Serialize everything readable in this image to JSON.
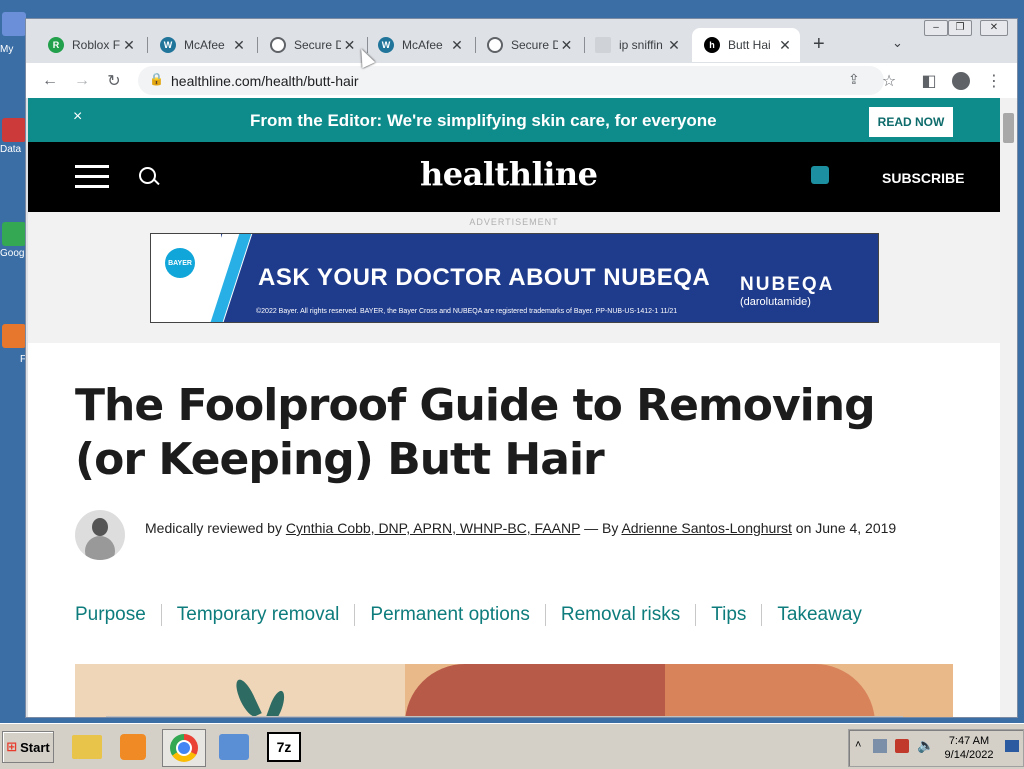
{
  "desktop": {
    "icons": [
      {
        "label": "My",
        "color": "#6b8fd8"
      },
      {
        "label": "Data",
        "color": "#cc3a3a"
      },
      {
        "label": "Goog",
        "color": "#34a853"
      },
      {
        "label": "F",
        "color": "#e8772e"
      }
    ]
  },
  "browser": {
    "tabs": [
      {
        "title": "Roblox F",
        "icon": "roblox-icon",
        "color": "#22a04b",
        "letter": "R"
      },
      {
        "title": "McAfee",
        "icon": "wordpress-icon",
        "color": "#21759b",
        "letter": "W"
      },
      {
        "title": "Secure D",
        "icon": "globe-icon",
        "color": "#5f6368",
        "letter": ""
      },
      {
        "title": "McAfee",
        "icon": "wordpress-icon",
        "color": "#21759b",
        "letter": "W"
      },
      {
        "title": "Secure D",
        "icon": "globe-icon",
        "color": "#5f6368",
        "letter": ""
      },
      {
        "title": "ip sniffin",
        "icon": "search-site-icon",
        "color": "#9aa0a6",
        "letter": ""
      },
      {
        "title": "Butt Hai",
        "icon": "healthline-icon",
        "color": "#000000",
        "letter": ""
      }
    ],
    "new_tab": "+",
    "url": "healthline.com/health/butt-hair"
  },
  "page": {
    "banner_text": "From the Editor: We're simplifying skin care, for everyone",
    "banner_close": "×",
    "read_now": "READ NOW",
    "logo": "healthline",
    "subscribe": "SUBSCRIBE",
    "ad_label": "ADVERTISEMENT",
    "ad": {
      "headline": "ASK YOUR DOCTOR ABOUT NUBEQA",
      "brand": "NUBEQA",
      "brand_sub": "(darolutamide)",
      "bayer": "BAYER",
      "fine_print": "©2022 Bayer. All rights reserved. BAYER, the Bayer Cross and NUBEQA are registered trademarks of Bayer. PP-NUB-US-1412-1 11/21"
    },
    "title": "The Foolproof Guide to Removing (or Keeping) Butt Hair",
    "byline": {
      "prefix": "Medically reviewed by ",
      "reviewer": "Cynthia Cobb, DNP, APRN, WHNP-BC, FAANP",
      "mid": " — By ",
      "author": "Adrienne Santos-Longhurst",
      "suffix": " on June 4, 2019"
    },
    "toc": [
      "Purpose",
      "Temporary removal",
      "Permanent options",
      "Removal risks",
      "Tips",
      "Takeaway"
    ]
  },
  "taskbar": {
    "start": "Start",
    "time": "7:47 AM",
    "date": "9/14/2022"
  }
}
